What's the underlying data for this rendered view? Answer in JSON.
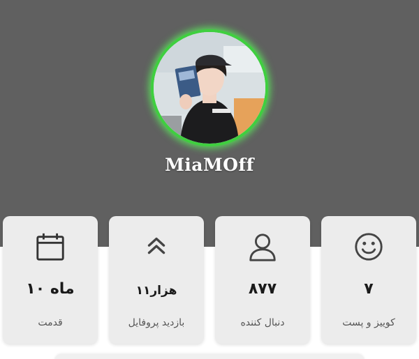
{
  "profile": {
    "username": "MiaMOff",
    "avatar_icon": "profile-photo",
    "ring_color": "#3fcf3f"
  },
  "stats": [
    {
      "icon": "smiley-icon",
      "value": "۷",
      "label": "کوییز و پست"
    },
    {
      "icon": "user-icon",
      "value": "۸۷۷",
      "label": "دنبال کننده"
    },
    {
      "icon": "double-chevron-up-icon",
      "value": "۱۱هزار",
      "label": "بازدید پروفایل"
    },
    {
      "icon": "calendar-icon",
      "value": "۱۰ ماه",
      "label": "قدمت"
    }
  ]
}
